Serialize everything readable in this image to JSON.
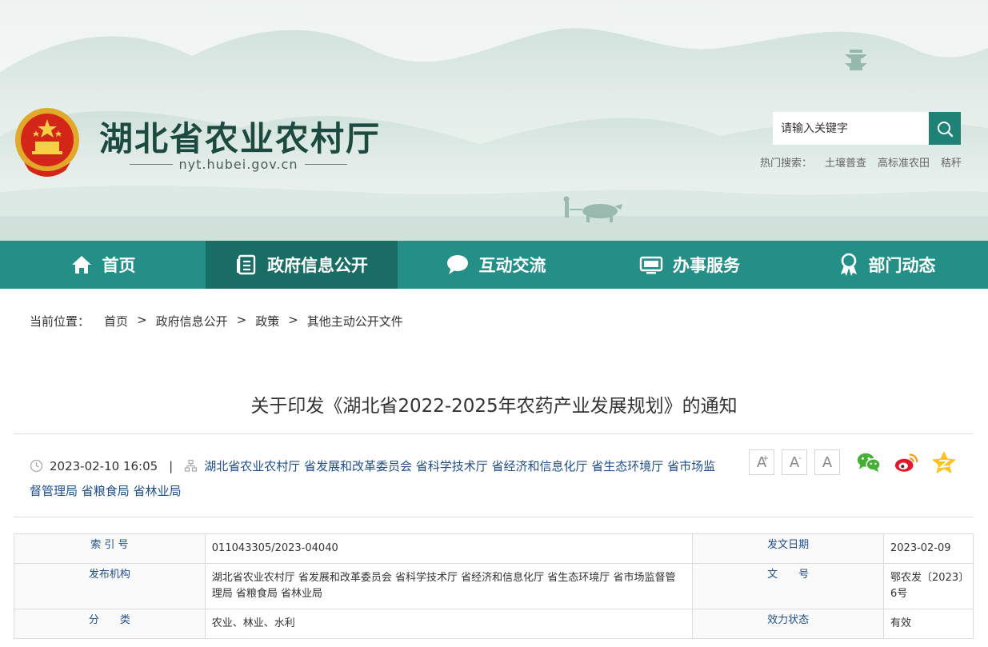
{
  "header": {
    "site_title": "湖北省农业农村厅",
    "site_domain": "nyt.hubei.gov.cn",
    "search_placeholder": "请输入关键字",
    "hot_label": "热门搜索：",
    "hot_terms": [
      "土壤普查",
      "高标准农田",
      "秸秆"
    ]
  },
  "nav": {
    "items": [
      {
        "label": "首页",
        "icon": "home-icon"
      },
      {
        "label": "政府信息公开",
        "icon": "document-list-icon",
        "active": true
      },
      {
        "label": "互动交流",
        "icon": "chat-bubble-icon"
      },
      {
        "label": "办事服务",
        "icon": "monitor-icon"
      },
      {
        "label": "部门动态",
        "icon": "award-ribbon-icon"
      }
    ]
  },
  "breadcrumb": {
    "label": "当前位置：",
    "items": [
      "首页",
      "政府信息公开",
      "政策",
      "其他主动公开文件"
    ],
    "separator": ">"
  },
  "article": {
    "title": "关于印发《湖北省2022-2025年农药产业发展规划》的通知",
    "datetime": "2023-02-10 16:05",
    "divider": "|",
    "publishers": "湖北省农业农村厅 省发展和改革委员会 省科学技术厅 省经济和信息化厅 省生态环境厅 省市场监督管理局 省粮食局 省林业局"
  },
  "font_controls": {
    "larger": "A",
    "larger_sup": "+",
    "smaller": "A",
    "smaller_sup": "-",
    "default": "A"
  },
  "share": [
    "wechat-icon",
    "weibo-icon",
    "qzone-star-icon"
  ],
  "info_table": {
    "rows": [
      {
        "k1": "索 引 号",
        "v1": "011043305/2023-04040",
        "k2": "发文日期",
        "v2": "2023-02-09"
      },
      {
        "k1": "发布机构",
        "v1": "湖北省农业农村厅 省发展和改革委员会 省科学技术厅 省经济和信息化厅 省生态环境厅 省市场监督管理局 省粮食局 省林业局",
        "k2": "文　　号",
        "v2": "鄂农发〔2023〕6号"
      },
      {
        "k1": "分　　类",
        "v1": "农业、林业、水利",
        "k2": "效力状态",
        "v2": "有效"
      }
    ]
  },
  "colors": {
    "nav_bg": "#248f86",
    "nav_active": "#1a6d65",
    "link_blue": "#1f4e8c",
    "title_green": "#1d4a3f"
  }
}
